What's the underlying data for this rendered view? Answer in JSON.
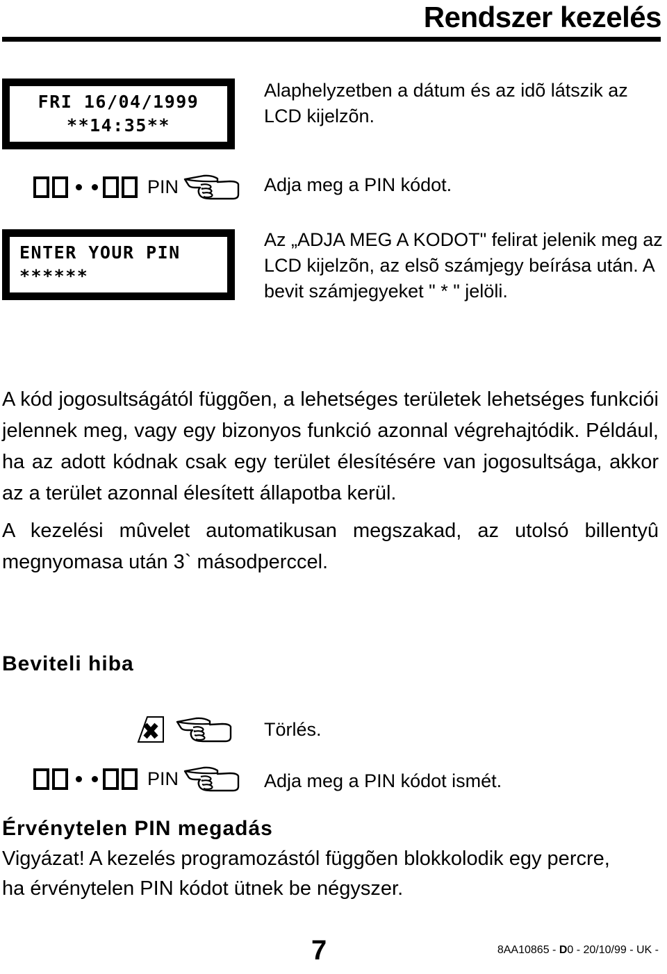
{
  "header": {
    "title": "Rendszer kezelés"
  },
  "steps": {
    "datetime": {
      "lcd_line1": "FRI 16/04/1999",
      "lcd_line2": "**14:35**",
      "instruction": "Alaphelyzetben a dátum és az idõ látszik az LCD kijelzõn."
    },
    "enter_pin_prompt": {
      "pin_label": "PIN",
      "instruction": "Adja meg a PIN kódot."
    },
    "pin_display": {
      "lcd_line1": "ENTER YOUR PIN",
      "lcd_line2": "******",
      "instruction": "Az „ADJA MEG A KODOT\" felirat jelenik meg az LCD kijelzõn, az elsõ számjegy beírása után. A bevit számjegyeket \" * \" jelöli."
    }
  },
  "paragraphs": {
    "authorization": "A kód jogosultságától függõen, a lehetséges területek lehetséges funkciói jelennek meg, vagy egy bizonyos funkció azonnal végrehajtódik. Például, ha az adott kódnak csak egy terület élesítésére van jogosultsága, akkor az a terület azonnal élesített állapotba kerül.",
    "timeout": "A kezelési mûvelet automatikusan megszakad, az utolsó billentyû megnyomasa után 3` másodperccel."
  },
  "input_error": {
    "heading": "Beviteli hiba",
    "clear_instruction": "Törlés.",
    "pin_label": "PIN",
    "retry_instruction": "Adja meg a PIN kódot ismét."
  },
  "invalid_pin": {
    "heading": "Érvénytelen PIN megadás",
    "warning": "Vigyázat! A kezelés programozástól függõen blokkolodik egy percre, ha érvénytelen PIN kódot ütnek be négyszer."
  },
  "footer": {
    "page_number": "7",
    "doc_code_prefix": "8AA10865 - ",
    "doc_code_bold": "D",
    "doc_code_suffix": "0 - 20/10/99 - UK -"
  }
}
